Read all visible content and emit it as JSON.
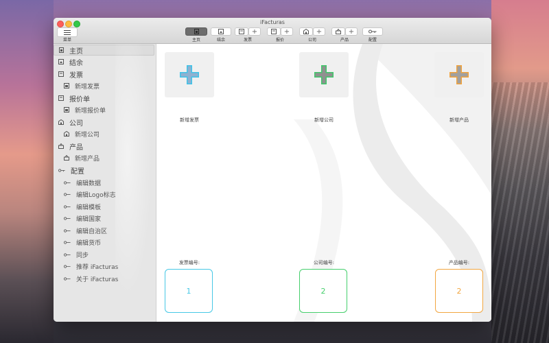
{
  "window": {
    "title": "iFacturas"
  },
  "toolbar": {
    "menu_label": "菜单",
    "buttons": [
      {
        "label": "主页",
        "icon": "home-doc-icon",
        "active": true
      },
      {
        "label": "结余",
        "icon": "balance-icon"
      },
      {
        "label": "发票",
        "icon": "invoice-icon",
        "plus": "+"
      },
      {
        "label": "报价",
        "icon": "quote-icon",
        "plus": "+"
      },
      {
        "label": "公司",
        "icon": "company-icon",
        "plus": "+"
      },
      {
        "label": "产品",
        "icon": "product-icon",
        "plus": "+"
      },
      {
        "label": "配置",
        "icon": "key-icon"
      }
    ]
  },
  "sidebar": {
    "items": [
      {
        "label": "主页",
        "icon": "home-doc-icon",
        "level": 0,
        "selected": true
      },
      {
        "label": "结余",
        "icon": "balance-icon",
        "level": 0
      },
      {
        "label": "发票",
        "icon": "invoice-icon",
        "level": 0
      },
      {
        "label": "新增发票",
        "icon": "invoice-icon",
        "level": 1
      },
      {
        "label": "报价单",
        "icon": "quote-icon",
        "level": 0
      },
      {
        "label": "新增报价单",
        "icon": "quote-icon",
        "level": 1
      },
      {
        "label": "公司",
        "icon": "company-icon",
        "level": 0
      },
      {
        "label": "新增公司",
        "icon": "company-icon",
        "level": 1
      },
      {
        "label": "产品",
        "icon": "product-icon",
        "level": 0
      },
      {
        "label": "新增产品",
        "icon": "product-icon",
        "level": 1
      },
      {
        "label": "配置",
        "icon": "key-icon",
        "level": 0
      },
      {
        "label": "编辑数据",
        "icon": "key-icon",
        "level": 1
      },
      {
        "label": "编辑Logo标志",
        "icon": "key-icon",
        "level": 1
      },
      {
        "label": "编辑模板",
        "icon": "key-icon",
        "level": 1
      },
      {
        "label": "编辑国家",
        "icon": "key-icon",
        "level": 1
      },
      {
        "label": "编辑自治区",
        "icon": "key-icon",
        "level": 1
      },
      {
        "label": "编辑货币",
        "icon": "key-icon",
        "level": 1
      },
      {
        "label": "同步",
        "icon": "key-icon",
        "level": 1
      },
      {
        "label": "推荐 iFacturas",
        "icon": "key-icon",
        "level": 1
      },
      {
        "label": "关于 iFacturas",
        "icon": "key-icon",
        "level": 1
      }
    ]
  },
  "main": {
    "add_tiles": [
      {
        "label": "新增发票",
        "color": "#3fc3e8",
        "accent": "#6fd2ee"
      },
      {
        "label": "新增公司",
        "color": "#3fc86a",
        "accent": "#7fd88f"
      },
      {
        "label": "新增产品",
        "color": "#f1a23c",
        "accent": "#a0a0a0"
      }
    ],
    "counters": [
      {
        "label": "发票编号:",
        "value": "1",
        "color": "#46c8e6"
      },
      {
        "label": "公司编号:",
        "value": "2",
        "color": "#45cf6c"
      },
      {
        "label": "产品编号:",
        "value": "2",
        "color": "#f2a640"
      }
    ]
  }
}
